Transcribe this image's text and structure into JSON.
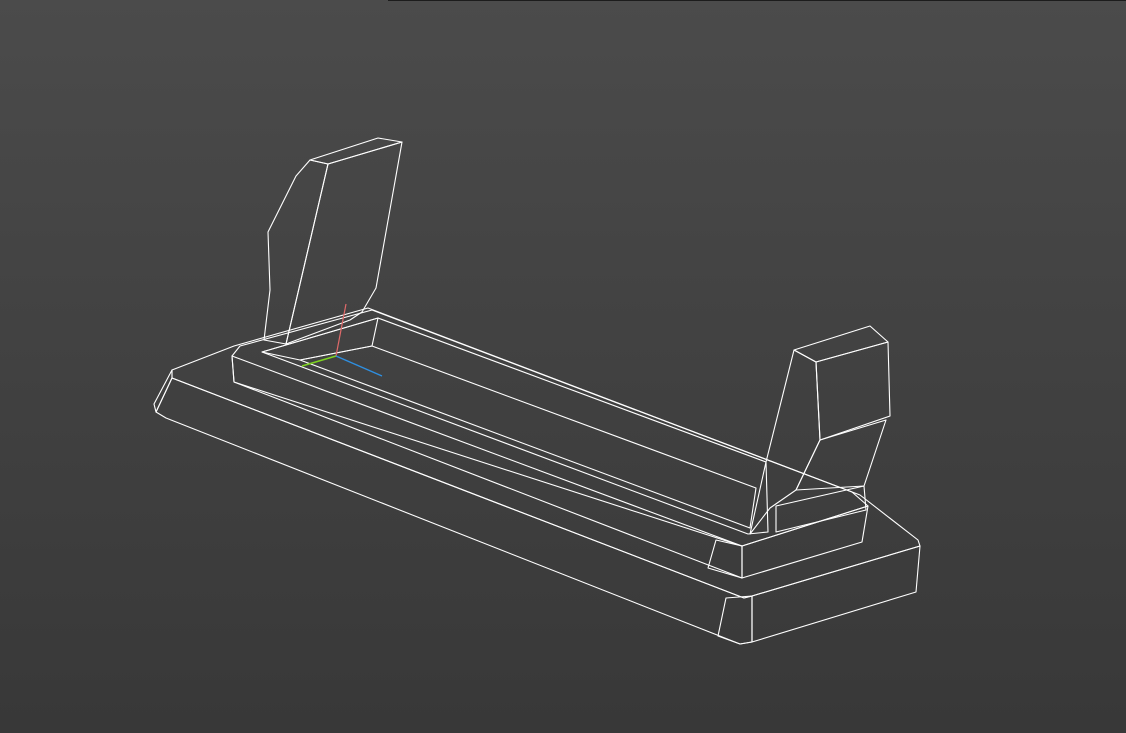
{
  "viewport": {
    "background_top": "#4b4b4b",
    "background_bottom": "#383838",
    "model_face_light": "#9a9a9a",
    "model_face_mid": "#8a8a8a",
    "model_face_dark": "#6f6f6f",
    "edge_color": "#ffffff"
  },
  "axis_triad": {
    "x_color": "#e06a6a",
    "y_color": "#7ed321",
    "z_color": "#2f8fe0"
  },
  "icons": [
    "axis-triad-icon"
  ]
}
